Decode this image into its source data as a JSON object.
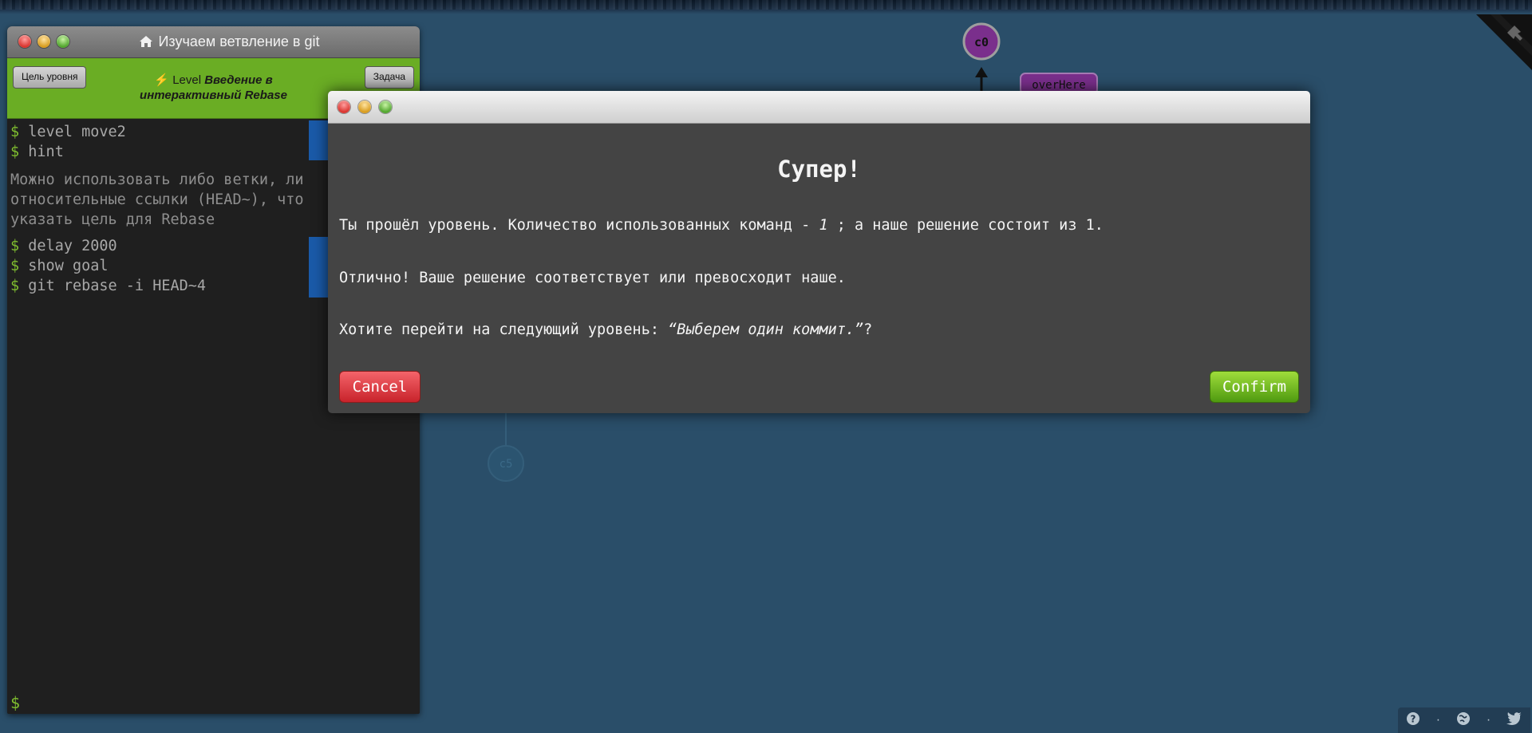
{
  "terminal": {
    "title": "Изучаем ветвление в git",
    "level_goal_button": "Цель уровня",
    "objective_button": "Задача",
    "level_prefix": "Level",
    "level_name_line1": "Введение в",
    "level_name_line2": "интерактивный Rebase",
    "lines_group1": [
      {
        "prompt": "$",
        "text": "level move2"
      },
      {
        "prompt": "$",
        "text": "hint"
      }
    ],
    "hint_output": "Можно использовать либо ветки, ли относительные ссылки (HEAD~), что указать цель для Rebase",
    "lines_group2": [
      {
        "prompt": "$",
        "text": "delay 2000"
      },
      {
        "prompt": "$",
        "text": "show goal"
      },
      {
        "prompt": "$",
        "text": "git rebase -i HEAD~4"
      }
    ],
    "bottom_prompt": "$"
  },
  "graph": {
    "commit_top": "c0",
    "branch_label": "overHere",
    "commit_bottom": "c5"
  },
  "modal": {
    "heading": "Супер!",
    "result_prefix": "Ты прошёл уровень. Количество использованных команд - ",
    "commands_used": "1",
    "result_suffix": " ; а наше решение состоит из 1.",
    "praise": "Отлично! Ваше решение соответствует или превосходит наше.",
    "next_prefix": "Хотите перейти на следующий уровень: ",
    "next_level_name": "“Выберем один коммит.”",
    "next_suffix": "?",
    "cancel_label": "Cancel",
    "confirm_label": "Confirm"
  },
  "footer": {
    "icons": [
      "help-icon",
      "globe-icon",
      "twitter-icon"
    ],
    "separator": "·"
  }
}
